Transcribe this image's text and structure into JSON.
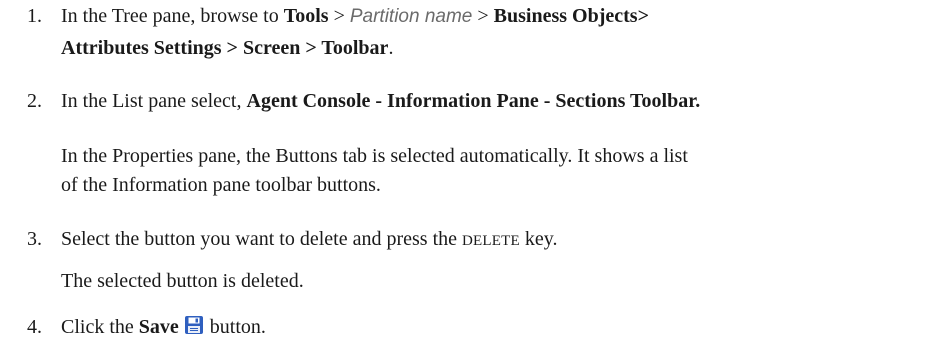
{
  "steps": [
    {
      "number": "1.",
      "line1_prefix": "In the Tree pane, browse to",
      "tools": "Tools",
      "sep1": " > ",
      "partition": "Partition name",
      "sep2": " > ",
      "business_objects": "Business Objects>",
      "line2": "Attributes Settings > Screen > Toolbar",
      "line2_end": "."
    },
    {
      "number": "2.",
      "prefix": "In the List pane select,",
      "bold": "Agent Console - Information Pane - Sections Toolbar.",
      "note_line1": "In the Properties pane, the Buttons tab is selected automatically. It shows a list",
      "note_line2": "of the Information pane toolbar buttons."
    },
    {
      "number": "3.",
      "prefix": "Select the button you want to delete and press the",
      "key": "DELETE",
      "suffix": "key.",
      "note": "The selected button is deleted."
    },
    {
      "number": "4.",
      "prefix": "Click the",
      "bold": "Save",
      "icon": "save-icon",
      "suffix": "button."
    }
  ],
  "colors": {
    "text": "#1a1a1a",
    "partition_text": "#6b6b6b",
    "save_icon": "#2f5fbf"
  }
}
